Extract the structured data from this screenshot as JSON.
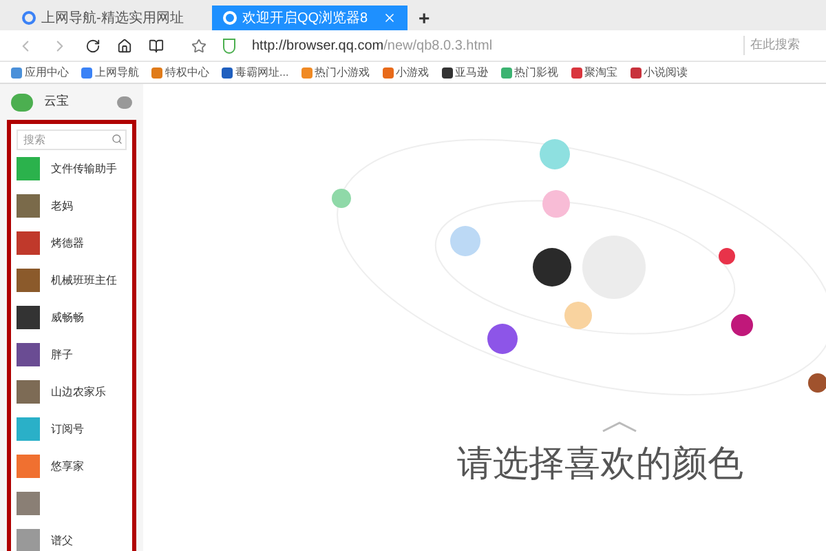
{
  "tabs": [
    {
      "title": "上网导航-精选实用网址",
      "selected": false
    },
    {
      "title": "欢迎开启QQ浏览器8",
      "selected": true
    }
  ],
  "new_tab": "+",
  "address_bar": {
    "url_host": "http://browser.qq.com",
    "url_path": "/new/qb8.0.3.html"
  },
  "search": {
    "placeholder": "在此搜索"
  },
  "bookmarks": [
    {
      "label": "应用中心",
      "color": "#4a90d9"
    },
    {
      "label": "上网导航",
      "color": "#3b82f6"
    },
    {
      "label": "特权中心",
      "color": "#e07b1a"
    },
    {
      "label": "毒霸网址...",
      "color": "#1f5fbf"
    },
    {
      "label": "热门小游戏",
      "color": "#f08a24"
    },
    {
      "label": "小游戏",
      "color": "#e86a1a"
    },
    {
      "label": "亚马逊",
      "color": "#333333"
    },
    {
      "label": "热门影视",
      "color": "#3cb371"
    },
    {
      "label": "聚淘宝",
      "color": "#d9363e"
    },
    {
      "label": "小说阅读",
      "color": "#c8323c"
    }
  ],
  "sidebar": {
    "account": "云宝",
    "search_placeholder": "搜索",
    "contacts": [
      {
        "name": "文件传输助手",
        "color": "#2bb24c"
      },
      {
        "name": "老妈",
        "color": "#7a6a4a"
      },
      {
        "name": "烤德器",
        "color": "#c0392b"
      },
      {
        "name": "机械班班主任",
        "color": "#8b5a2b"
      },
      {
        "name": "威畅畅",
        "color": "#333333"
      },
      {
        "name": "胖子",
        "color": "#6a4c93"
      },
      {
        "name": "山边农家乐",
        "color": "#7d6b55"
      },
      {
        "name": "订阅号",
        "color": "#2ab0c8"
      },
      {
        "name": "悠享家",
        "color": "#f07030"
      },
      {
        "color": "#8a7f75"
      },
      {
        "name": "谱父",
        "color": "#999999"
      }
    ]
  },
  "color_picker": {
    "title": "请选择喜欢的颜色",
    "colors": [
      {
        "color": "#8ee0e0"
      },
      {
        "color": "#8fd9a8"
      },
      {
        "color": "#f8bcd6"
      },
      {
        "color": "#bcd9f5"
      },
      {
        "color": "#2a2a2a"
      },
      {
        "color": "#ececec"
      },
      {
        "color": "#e8334a"
      },
      {
        "color": "#f9d39f"
      },
      {
        "color": "#c0187a"
      },
      {
        "color": "#8d55e8"
      },
      {
        "color": "#a0522d"
      }
    ]
  }
}
